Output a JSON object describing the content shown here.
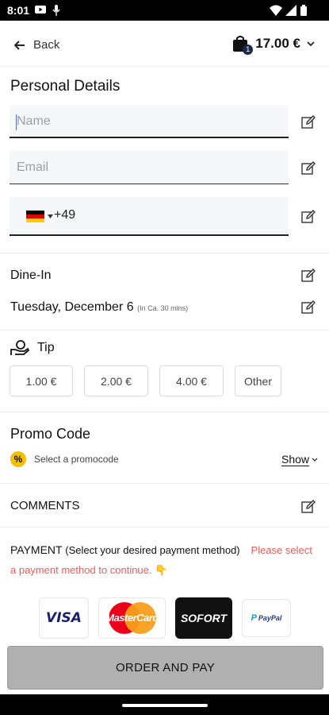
{
  "status_bar": {
    "time": "8:01"
  },
  "header": {
    "back_label": "Back",
    "cart_count": "1",
    "cart_total": "17.00 €"
  },
  "personal_details": {
    "title": "Personal Details",
    "name_placeholder": "Name",
    "email_placeholder": "Email",
    "phone_country_code": "+49"
  },
  "order_type": {
    "label": "Dine-In",
    "date": "Tuesday, December 6",
    "eta": "(In Ca. 30 mins)"
  },
  "tip": {
    "title": "Tip",
    "options": [
      "1.00 €",
      "2.00 €",
      "4.00 €",
      "Other"
    ]
  },
  "promo": {
    "title": "Promo Code",
    "badge": "%",
    "select_label": "Select a promocode",
    "show_label": "Show"
  },
  "comments": {
    "title": "COMMENTS"
  },
  "payment": {
    "title": "PAYMENT",
    "instruction": "(Select your desired payment method)",
    "warning": "Please select a payment method to continue. 👇",
    "methods": [
      "VISA",
      "MasterCard",
      "SOFORT",
      "PayPal"
    ]
  },
  "order_button": {
    "label": "ORDER AND PAY"
  },
  "colors": {
    "warning": "#ee5c5c",
    "promo_badge": "#f4c000",
    "order_button": "#b0b0b0",
    "sofort_bg": "#111111",
    "visa_blue": "#1a1f71"
  }
}
